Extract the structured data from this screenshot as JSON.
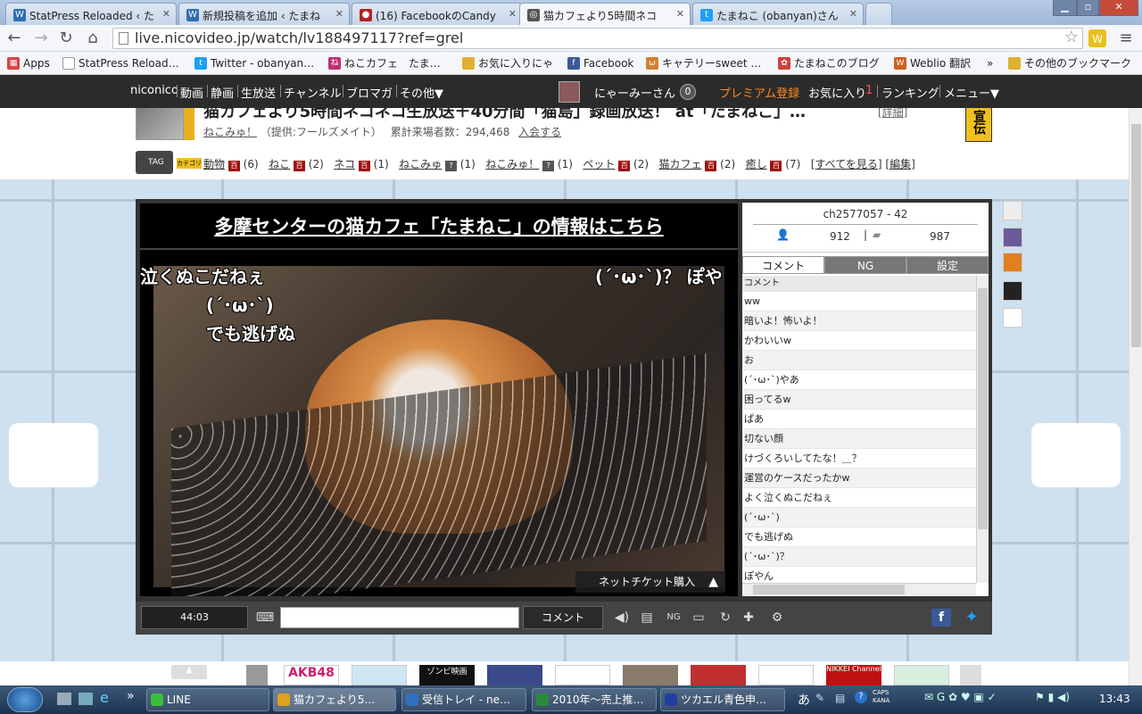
{
  "browser": {
    "tabs": [
      {
        "title": "StatPress Reloaded ‹ た",
        "icon_color": "#2f6fb0"
      },
      {
        "title": "新規投稿を追加 ‹ たまね",
        "icon_color": "#2f6fb0"
      },
      {
        "title": "(16) FacebookのCandy",
        "icon_color": "#b22222"
      },
      {
        "title": "猫カフェより5時間ネコ",
        "icon_color": "#555555",
        "active": true
      },
      {
        "title": "たまねこ (obanyan)さん",
        "icon_color": "#1da1f2"
      }
    ],
    "url": "live.nicovideo.jp/watch/lv188497117?ref=grel",
    "bookmarks": [
      {
        "label": "Apps",
        "icon_color": "#e04040"
      },
      {
        "label": "StatPress Reload…",
        "icon_color": "#999999"
      },
      {
        "label": "Twitter - obanyan…",
        "icon_color": "#1da1f2"
      },
      {
        "label": "ねこカフェ　たま…",
        "icon_color": "#c03070"
      },
      {
        "label": "お気に入りにゃ",
        "icon_color": "#e0b030"
      },
      {
        "label": "Facebook",
        "icon_color": "#3b5998"
      },
      {
        "label": "キャテリーsweet …",
        "icon_color": "#d08030"
      },
      {
        "label": "たまねこのブログ",
        "icon_color": "#d04040"
      },
      {
        "label": "Weblio 翻訳",
        "icon_color": "#d06020"
      },
      {
        "label": "»",
        "icon_color": ""
      },
      {
        "label": "その他のブックマーク",
        "icon_color": "#e0b030"
      }
    ]
  },
  "nico_header": {
    "links": [
      "niconico",
      "動画",
      "静画",
      "生放送",
      "チャンネル",
      "ブロマガ",
      "その他▼"
    ],
    "username": "にゃーみーさん",
    "points": "0",
    "premium": "プレミアム登録",
    "favorites": "お気に入り",
    "favorites_count": "1",
    "ranking": "ランキング",
    "menu": "メニュー▼"
  },
  "program": {
    "title": "猫カフェより5時間ネコネコ生放送＋40分間「猫島」録画放送！ at「たまねこ」…",
    "detail_link": "[詳細]",
    "channel": "ねこみゅ！",
    "provider": "（提供:フールズメイト）",
    "visitors_label": "累計来場者数：294,468",
    "join": "入会する",
    "ad_badge": "宣伝"
  },
  "tags": {
    "label": "TAG",
    "category_label": "カテゴリ",
    "items": [
      {
        "name": "動物",
        "count": "(6)"
      },
      {
        "name": "ねこ",
        "count": "(2)"
      },
      {
        "name": "ネコ",
        "count": "(1)"
      },
      {
        "name": "ねこみゅ",
        "count": "(1)"
      },
      {
        "name": "ねこみゅ！",
        "count": "(1)"
      },
      {
        "name": "ペット",
        "count": "(2)"
      },
      {
        "name": "猫カフェ",
        "count": "(2)"
      },
      {
        "name": "癒し",
        "count": "(7)"
      }
    ],
    "see_all": "[すべてを見る]",
    "edit": "[編集]"
  },
  "player": {
    "banner": "多摩センターの猫カフェ「たまねこ」の情報はこちら",
    "overlay_comments": [
      "泣くぬこだねぇ",
      "(´･ω･`)",
      "でも逃げぬ",
      "(´･ω･`)？ ぽや"
    ],
    "ticket": "ネットチケット購入",
    "channel_id": "ch2577057 - 42",
    "viewers": "912",
    "comments_count": "987",
    "panel_tabs": [
      "コメント",
      "NG",
      "設定"
    ],
    "list_header": "コメント",
    "comments": [
      "ww",
      "暗いよ！怖いよ！",
      "かわいいw",
      "お",
      "(´･ω･`)やあ",
      "困ってるw",
      "ぱあ",
      "切ない顔",
      "けづくろいしてたな！＿？",
      "運営のケースだったかw",
      "よく泣くぬこだねぇ",
      "(´･ω･`)",
      "でも逃げぬ",
      "(´･ω･`)？",
      "ぽやん"
    ],
    "time": "44:03",
    "comment_button": "コメント"
  },
  "bottom_thumbs": [
    "AKB48",
    "ゾンビ映画",
    "NIKKEI Channel"
  ],
  "taskbar": {
    "items": [
      {
        "label": "LINE",
        "icon_color": "#3bbf3b"
      },
      {
        "label": "猫カフェより5…",
        "icon_color": "#e0a020"
      },
      {
        "label": "受信トレイ - ne…",
        "icon_color": "#3070c0"
      },
      {
        "label": "2010年～売上推…",
        "icon_color": "#2a8a3a"
      },
      {
        "label": "ツカエル青色申…",
        "icon_color": "#2040a0"
      }
    ],
    "ime": "あ",
    "ime_mode": "CAPS KANA",
    "clock": "13:43"
  },
  "colors": {
    "nico_bar": "#2b2b2b",
    "premium": "#ff8a1f",
    "page_bg_blue": "#cfe0ee",
    "facebook": "#3b5998",
    "twitter": "#1da1f2"
  }
}
